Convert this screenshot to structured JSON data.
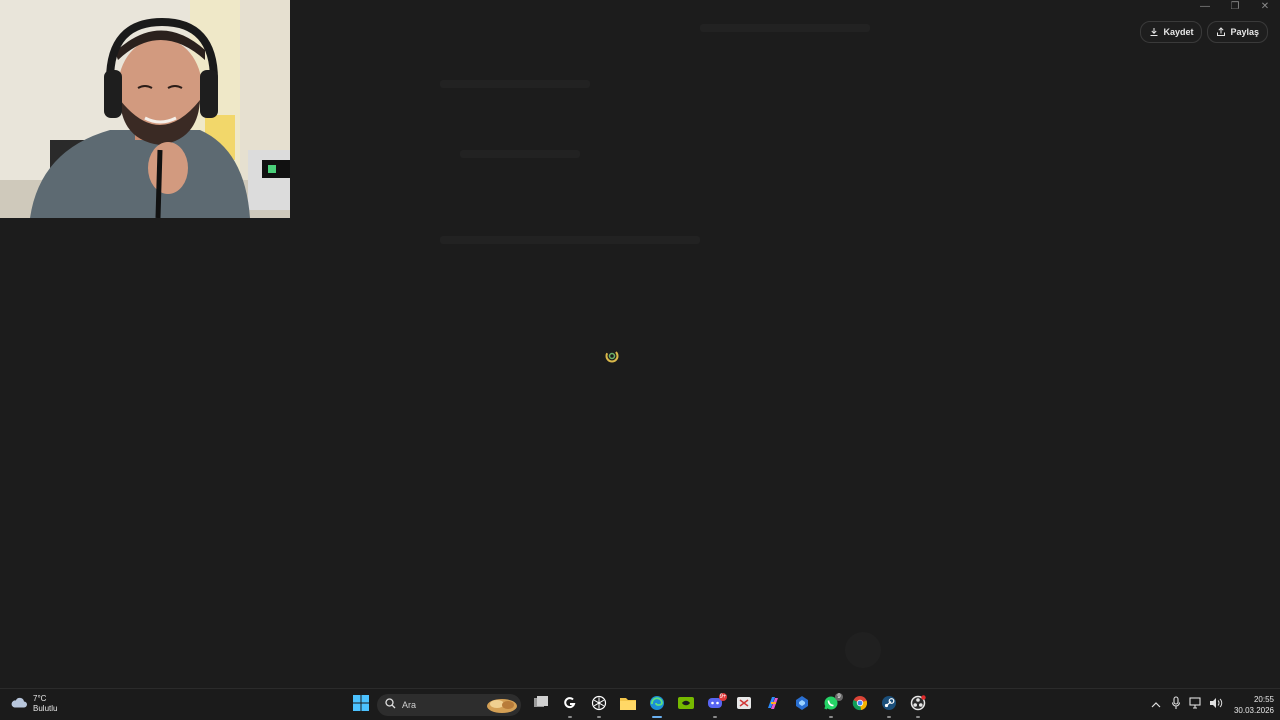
{
  "window": {
    "controls": {
      "minimize": "—",
      "restore": "❐",
      "close": "✕"
    },
    "actions": {
      "save_label": "Kaydet",
      "share_label": "Paylaş"
    }
  },
  "loader": {
    "glyph": "spinner-icon"
  },
  "taskbar": {
    "weather": {
      "temperature": "7°C",
      "condition": "Bulutlu"
    },
    "search": {
      "placeholder": "Ara"
    },
    "apps": [
      {
        "name": "start-button"
      },
      {
        "name": "search-box"
      },
      {
        "name": "task-view-button"
      },
      {
        "name": "app-logitech-g"
      },
      {
        "name": "app-chatgpt"
      },
      {
        "name": "app-file-explorer"
      },
      {
        "name": "app-edge"
      },
      {
        "name": "app-nvidia"
      },
      {
        "name": "app-discord",
        "badge": "9+"
      },
      {
        "name": "app-snipping-tool"
      },
      {
        "name": "app-copilot"
      },
      {
        "name": "app-microsoft-365"
      },
      {
        "name": "app-whatsapp",
        "badge": "9"
      },
      {
        "name": "app-chrome"
      },
      {
        "name": "app-steam"
      },
      {
        "name": "app-obs"
      }
    ],
    "tray": {
      "date": "30.03.2026",
      "time": "20:55"
    }
  },
  "colors": {
    "accent": "#4cc2ff",
    "background": "#1c1c1c",
    "taskbar": "#1b1b1b"
  }
}
